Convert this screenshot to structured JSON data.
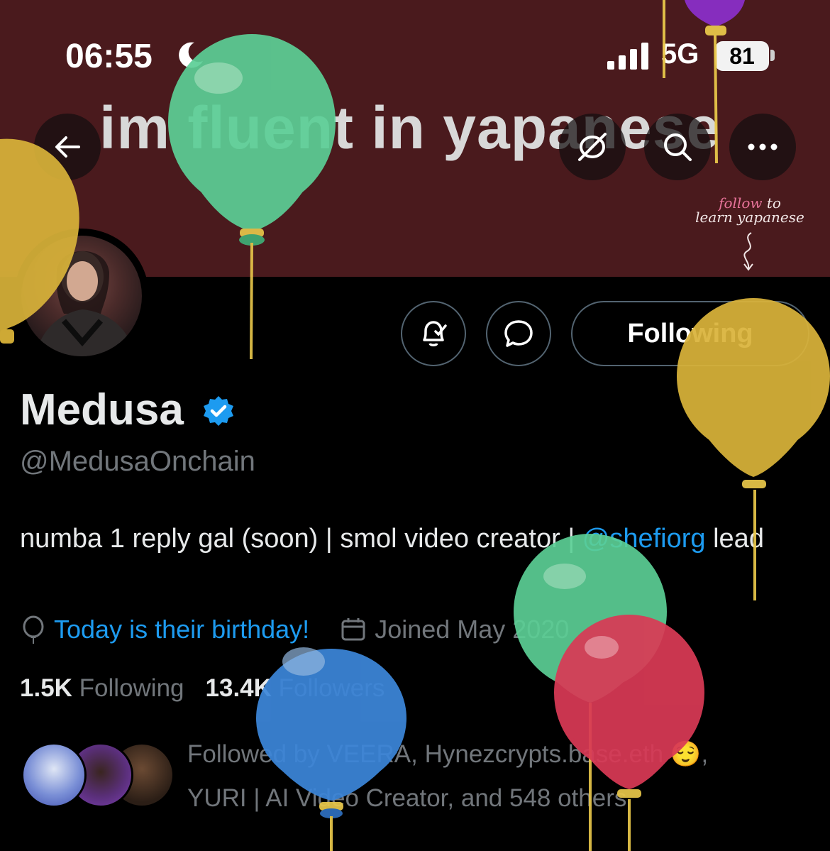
{
  "status_bar": {
    "time": "06:55",
    "network": "5G",
    "battery": "81"
  },
  "banner": {
    "text": "im fluent in yapanese",
    "note_line1_pink": "follow",
    "note_line1_rest": " to",
    "note_line2": "learn yapanese"
  },
  "nav": {
    "back_icon": "arrow-left-icon",
    "hide_icon": "eye-slash-icon",
    "search_icon": "search-icon",
    "more_icon": "more-horizontal-icon"
  },
  "actions": {
    "following_label": "Following"
  },
  "profile": {
    "display_name": "Medusa",
    "handle": "@MedusaOnchain",
    "bio_text": "numba 1 reply gal (soon) | smol video creator | ",
    "bio_mention": "@shefiorg",
    "bio_text_end": " lead",
    "birthday": "Today is their birthday!",
    "joined": "Joined May 2020"
  },
  "stats": {
    "following_count": "1.5K",
    "following_label": "Following",
    "followers_count": "13.4K",
    "followers_label": "Followers"
  },
  "followed_by": {
    "text_line1": "Followed by VEERA, Hynezcrypts.base.eth 😌,",
    "text_line2": "YURI | AI Video Creator, and 548 others"
  },
  "colors": {
    "banner": "#4a1a1d",
    "accent_blue": "#1d9bf0",
    "muted": "#71767b",
    "balloon_green": "#5ccf96",
    "balloon_yellow": "#d9b33a",
    "balloon_blue": "#3c86d9",
    "balloon_red": "#d93a55",
    "balloon_purple": "#8a2fc7"
  }
}
